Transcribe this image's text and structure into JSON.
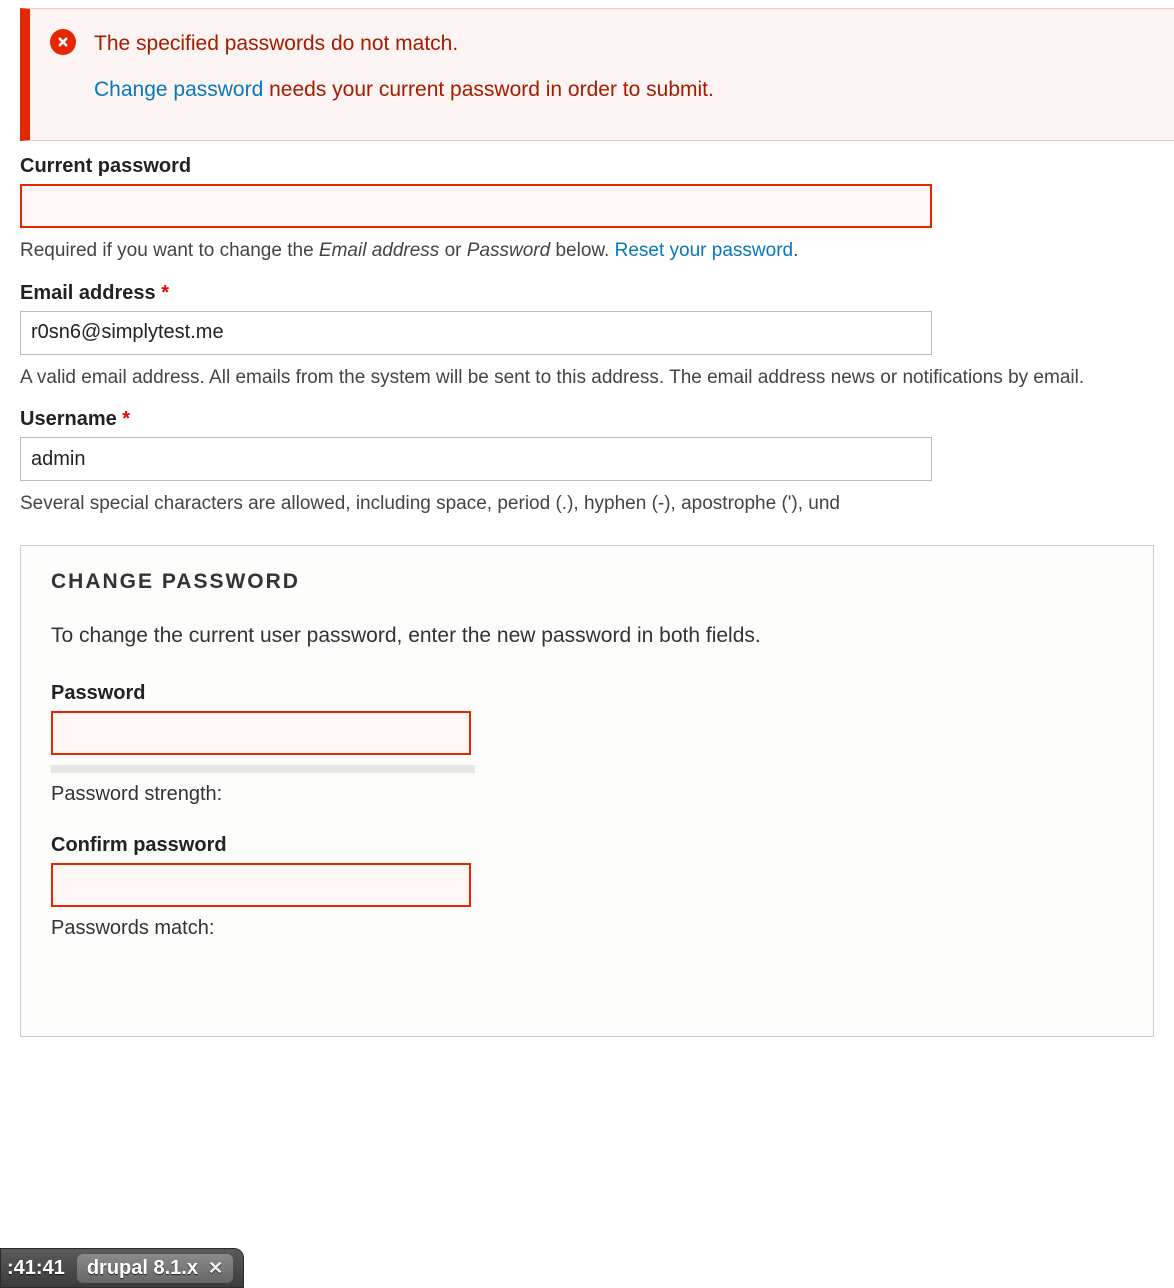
{
  "error": {
    "msg1": "The specified passwords do not match.",
    "link": "Change password",
    "msg2_suffix": " needs your current password in order to submit."
  },
  "current_password": {
    "label": "Current password",
    "value": "",
    "desc_prefix": "Required if you want to change the ",
    "desc_em1": "Email address",
    "desc_mid": " or ",
    "desc_em2": "Password",
    "desc_suffix": " below. ",
    "reset_link": "Reset your password",
    "desc_end": "."
  },
  "email": {
    "label": "Email address ",
    "value": "r0sn6@simplytest.me",
    "desc": "A valid email address. All emails from the system will be sent to this address. The email address news or notifications by email."
  },
  "username": {
    "label": "Username ",
    "value": "admin",
    "desc": "Several special characters are allowed, including space, period (.), hyphen (-), apostrophe ('), und"
  },
  "change_password": {
    "title": "CHANGE PASSWORD",
    "desc": "To change the current user password, enter the new password in both fields.",
    "password_label": "Password",
    "password_value": "",
    "strength_label": "Password strength:",
    "confirm_label": "Confirm password",
    "confirm_value": "",
    "match_label": "Passwords match:"
  },
  "taskbar": {
    "time": ":41:41",
    "tab_label": "drupal 8.1.x"
  },
  "required_marker": "*"
}
